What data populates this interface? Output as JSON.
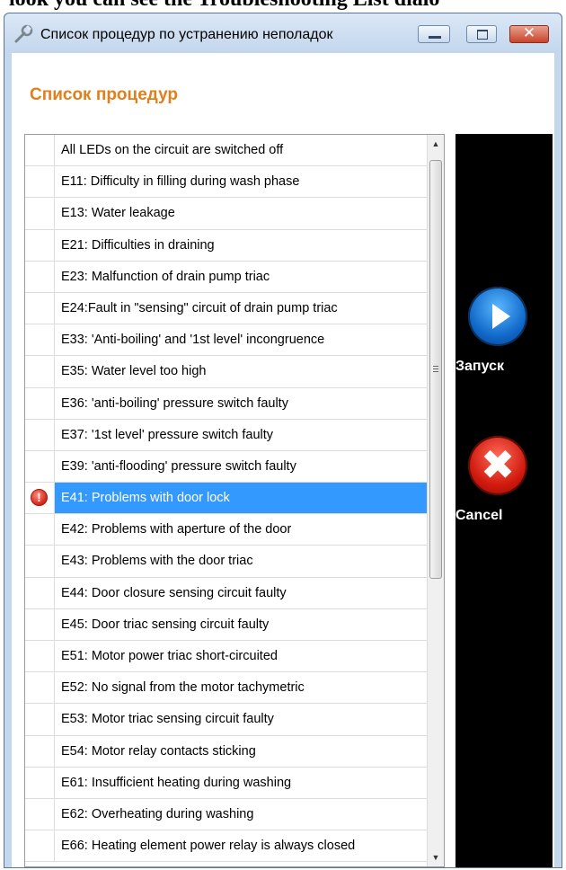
{
  "caption_fragment": "look you can see the Troubleshooting List dialo",
  "window": {
    "title": "Список процедур по устранению неполадок",
    "app_icon": "wrench-icon",
    "controls": {
      "minimize": "minimize-icon",
      "maximize": "maximize-icon",
      "close_glyph": "✕"
    }
  },
  "section_title": "Список процедур",
  "list": {
    "selected_index": 11,
    "status_icon": "error-icon",
    "status_glyph": "!",
    "items": [
      "All LEDs on the circuit are switched off",
      "E11: Difficulty in filling during wash phase",
      "E13: Water leakage",
      "E21: Difficulties in draining",
      "E23: Malfunction of drain pump triac",
      "E24:Fault in \"sensing\" circuit of drain pump triac",
      "E33: 'Anti-boiling' and '1st level' incongruence",
      "E35: Water level too high",
      "E36: 'anti-boiling' pressure switch faulty",
      "E37: '1st level' pressure switch faulty",
      "E39: 'anti-flooding' pressure switch faulty",
      "E41: Problems with door lock",
      "E42: Problems with aperture of the door",
      "E43: Problems with the door triac",
      "E44: Door closure sensing circuit faulty",
      "E45: Door triac sensing circuit faulty",
      "E51: Motor power triac short-circuited",
      "E52: No signal from the motor tachymetric",
      "E53: Motor triac sensing circuit faulty",
      "E54: Motor relay contacts sticking",
      "E61: Insufficient heating during washing",
      "E62: Overheating during washing",
      "E66: Heating element power relay is always closed"
    ],
    "scrollbar": {
      "up_glyph": "▲",
      "down_glyph": "▼"
    }
  },
  "actions": {
    "run": {
      "label": "Запуск",
      "icon": "play-icon"
    },
    "cancel": {
      "label": "Cancel",
      "icon": "cancel-icon",
      "glyph": "✖"
    }
  }
}
